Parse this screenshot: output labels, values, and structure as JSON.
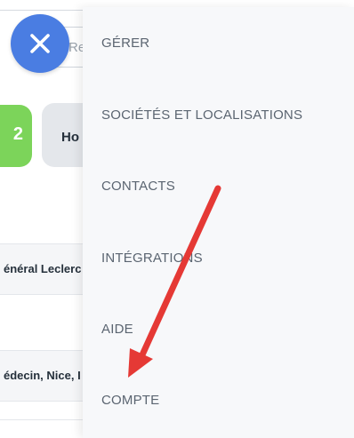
{
  "background": {
    "search_placeholder": "Re",
    "green_button_text": "2",
    "grey_button_text": "Ho",
    "row_1_text": "énéral Leclerc",
    "row_2_text": "édecin, Nice, I"
  },
  "close_button": {
    "icon": "close-icon",
    "color": "#4a7de2"
  },
  "menu": {
    "items": [
      {
        "label": "GÉRER"
      },
      {
        "label": "SOCIÉTÉS ET LOCALISATIONS"
      },
      {
        "label": "CONTACTS"
      },
      {
        "label": "INTÉGRATIONS"
      },
      {
        "label": "AIDE"
      },
      {
        "label": "COMPTE"
      }
    ]
  },
  "annotation": {
    "arrow_color": "#e53935"
  }
}
